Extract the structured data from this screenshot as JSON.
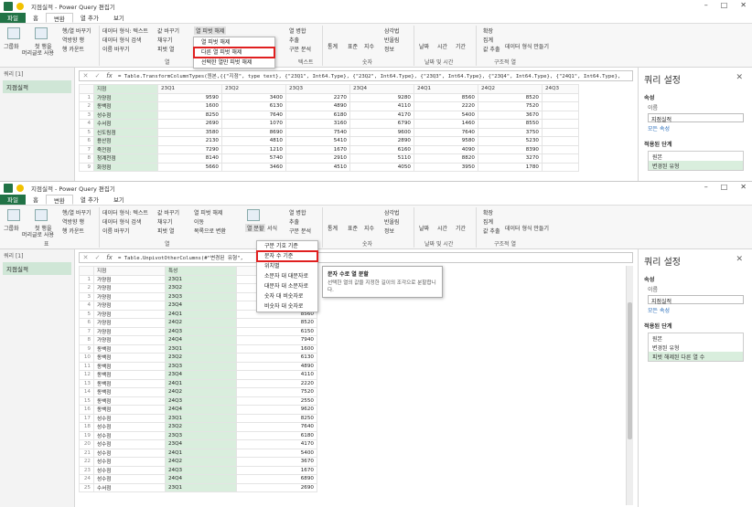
{
  "w1": {
    "title": "지점실적 - Power Query 편집기",
    "tabs": [
      "파일",
      "홈",
      "변환",
      "열 추가",
      "보기"
    ],
    "ribbon": {
      "group_table": [
        "그룹화",
        "첫 행을",
        "머리글로 사용"
      ],
      "small1": [
        "행/열 바꾸기",
        "역방향 행",
        "행 카운트"
      ],
      "small2": [
        "데이터 형식: 텍스트",
        "데이터 형식 검색",
        "이름 바꾸기"
      ],
      "small3": [
        "값 바꾸기",
        "채우기",
        "피벗 열"
      ],
      "unpivot_btn": "열 피벗 해제",
      "split_etc": [
        "열 병합",
        "추출",
        "구문 분석"
      ],
      "right": [
        "통계",
        "표준",
        "지수",
        "삼각법",
        "반올림",
        "정보",
        "날짜",
        "시간",
        "기간",
        "확장",
        "집계",
        "값 추출",
        "데이터 형식 만들기"
      ],
      "groups": [
        "열",
        "텍스트",
        "숫자",
        "날짜 및 시간",
        "구조적 열"
      ]
    },
    "menu": [
      "열 피벗 해제",
      "다른 열 피벗 해제",
      "선택한 열만 피벗 해제"
    ],
    "queries_head": "쿼리 [1]",
    "query_name": "지점실적",
    "formula": "= Table.TransformColumnTypes(원본,{{\"지점\", type text}, {\"23Q1\", Int64.Type}, {\"23Q2\", Int64.Type}, {\"23Q3\", Int64.Type}, {\"23Q4\", Int64.Type}, {\"24Q1\", Int64.Type},",
    "columns": [
      "지점",
      "23Q1",
      "23Q2",
      "23Q3",
      "23Q4",
      "24Q1",
      "24Q2",
      "24Q3"
    ],
    "rows": [
      [
        "가양점",
        "9590",
        "3400",
        "2270",
        "9280",
        "8560",
        "8520"
      ],
      [
        "동백점",
        "1600",
        "6130",
        "4890",
        "4110",
        "2220",
        "7520"
      ],
      [
        "성수점",
        "8250",
        "7640",
        "6180",
        "4170",
        "5400",
        "3670"
      ],
      [
        "수서점",
        "2690",
        "1070",
        "3160",
        "6790",
        "1460",
        "8550"
      ],
      [
        "신도림점",
        "3580",
        "8690",
        "7540",
        "9600",
        "7640",
        "3750"
      ],
      [
        "용산점",
        "2130",
        "4810",
        "5410",
        "2890",
        "9580",
        "5230"
      ],
      [
        "죽전점",
        "7290",
        "1210",
        "1670",
        "6160",
        "4090",
        "8390"
      ],
      [
        "청계천점",
        "8140",
        "5740",
        "2910",
        "5110",
        "8820",
        "3270"
      ],
      [
        "화정점",
        "5660",
        "3460",
        "4510",
        "4050",
        "3950",
        "1780"
      ]
    ],
    "settings": {
      "title": "쿼리 설정",
      "props": "속성",
      "name_label": "이름",
      "name_value": "지점실적",
      "all_props": "모든 속성",
      "steps_label": "적용된 단계",
      "steps": [
        "원본",
        "변경된 유형"
      ]
    }
  },
  "w2": {
    "title": "지점실적 - Power Query 편집기",
    "tabs": [
      "파일",
      "홈",
      "변환",
      "열 추가",
      "보기"
    ],
    "ribbon": {
      "group_table": [
        "그룹화",
        "첫 행을",
        "머리글로 사용"
      ],
      "small1": [
        "행/열 바꾸기",
        "역방향 행",
        "행 카운트"
      ],
      "small2": [
        "데이터 형식: 텍스트",
        "데이터 형식 검색",
        "이름 바꾸기"
      ],
      "small3": [
        "값 바꾸기",
        "채우기",
        "피벗 열"
      ],
      "small4": [
        "열 피벗 해제",
        "이동",
        "목록으로 변환"
      ],
      "split_btn": "열 분할",
      "format_btn": "서식",
      "split_etc": [
        "열 병합",
        "추출",
        "구문 분석"
      ],
      "right": [
        "통계",
        "표준",
        "지수",
        "삼각법",
        "반올림",
        "정보",
        "날짜",
        "시간",
        "기간",
        "확장",
        "집계",
        "값 추출",
        "데이터 형식 만들기"
      ],
      "groups": [
        "표",
        "열",
        "숫자",
        "날짜 및 시간",
        "구조적 열"
      ]
    },
    "menu": [
      "구분 기호 기준",
      "문자 수 기준",
      "위치별",
      "소문자 대 대문자로",
      "대문자 대 소문자로",
      "숫자 대 비숫자로",
      "비숫자 대 숫자로"
    ],
    "tooltip_title": "문자 수로 열 분할",
    "tooltip_desc": "선택한 열의 값을 지정한 길이의 조각으로 분할합니다.",
    "queries_head": "쿼리 [1]",
    "query_name": "지점실적",
    "formula": "= Table.UnpivotOtherColumns(#\"변경된 유형\",",
    "columns": [
      "지점",
      "특성"
    ],
    "rows": [
      [
        "1",
        "가양점",
        "23Q1",
        ""
      ],
      [
        "2",
        "가양점",
        "23Q2",
        ""
      ],
      [
        "3",
        "가양점",
        "23Q3",
        ""
      ],
      [
        "4",
        "가양점",
        "23Q4",
        ""
      ],
      [
        "5",
        "가양점",
        "24Q1",
        "8560"
      ],
      [
        "6",
        "가양점",
        "24Q2",
        "8520"
      ],
      [
        "7",
        "가양점",
        "24Q3",
        "6150"
      ],
      [
        "8",
        "가양점",
        "24Q4",
        "7940"
      ],
      [
        "9",
        "동백점",
        "23Q1",
        "1600"
      ],
      [
        "10",
        "동백점",
        "23Q2",
        "6130"
      ],
      [
        "11",
        "동백점",
        "23Q3",
        "4890"
      ],
      [
        "12",
        "동백점",
        "23Q4",
        "4110"
      ],
      [
        "13",
        "동백점",
        "24Q1",
        "2220"
      ],
      [
        "14",
        "동백점",
        "24Q2",
        "7520"
      ],
      [
        "15",
        "동백점",
        "24Q3",
        "2550"
      ],
      [
        "16",
        "동백점",
        "24Q4",
        "9620"
      ],
      [
        "17",
        "성수점",
        "23Q1",
        "8250"
      ],
      [
        "18",
        "성수점",
        "23Q2",
        "7640"
      ],
      [
        "19",
        "성수점",
        "23Q3",
        "6180"
      ],
      [
        "20",
        "성수점",
        "23Q4",
        "4170"
      ],
      [
        "21",
        "성수점",
        "24Q1",
        "5400"
      ],
      [
        "22",
        "성수점",
        "24Q2",
        "3670"
      ],
      [
        "23",
        "성수점",
        "24Q3",
        "1670"
      ],
      [
        "24",
        "성수점",
        "24Q4",
        "6890"
      ],
      [
        "25",
        "수서점",
        "23Q1",
        "2690"
      ]
    ],
    "settings": {
      "title": "쿼리 설정",
      "props": "속성",
      "name_label": "이름",
      "name_value": "지점실적",
      "all_props": "모든 속성",
      "steps_label": "적용된 단계",
      "steps": [
        "원본",
        "변경된 유형",
        "피벗 해제된 다른 열 수"
      ]
    }
  },
  "colors": {
    "accent": "#217346",
    "selected": "#d9eedd",
    "highlight": "#e02020"
  }
}
